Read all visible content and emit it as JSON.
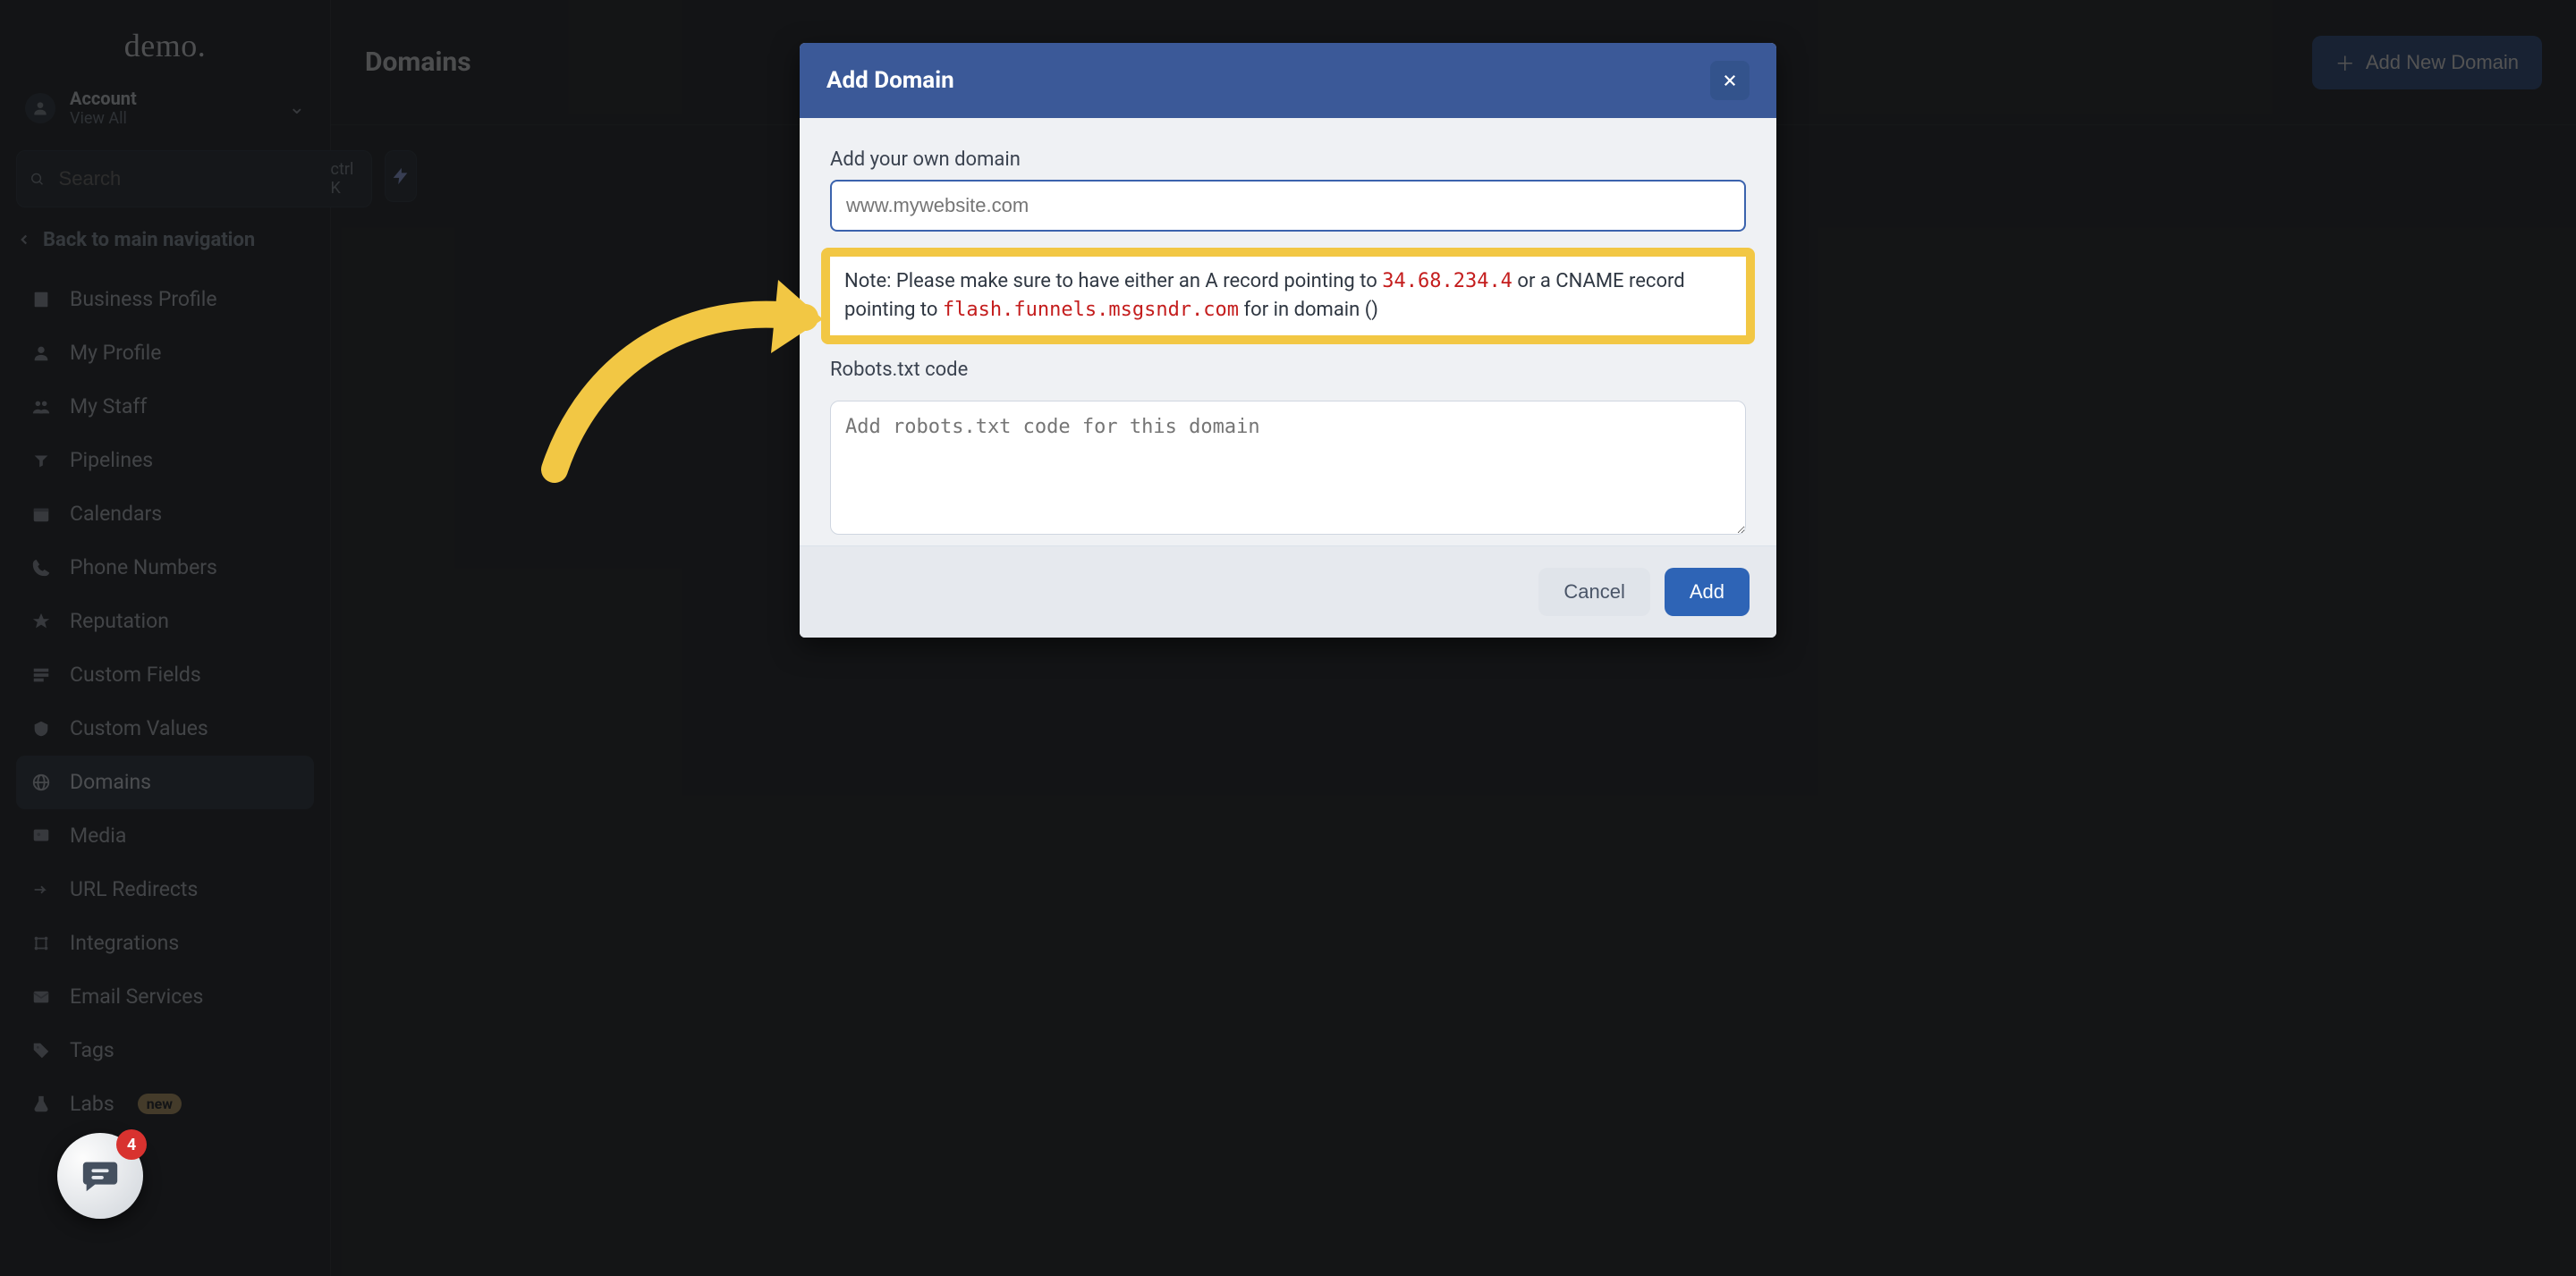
{
  "brand": {
    "logo_text": "demo."
  },
  "account": {
    "title": "Account",
    "view_text": "View All",
    "caret": "⌄"
  },
  "search": {
    "placeholder": "Search",
    "shortcut": "ctrl K"
  },
  "back_link": "Back to main navigation",
  "sidebar": {
    "items": [
      {
        "icon": "building-icon",
        "label": "Business Profile"
      },
      {
        "icon": "user-icon",
        "label": "My Profile"
      },
      {
        "icon": "team-icon",
        "label": "My Staff"
      },
      {
        "icon": "pipeline-icon",
        "label": "Pipelines"
      },
      {
        "icon": "calendar-icon",
        "label": "Calendars"
      },
      {
        "icon": "phone-icon",
        "label": "Phone Numbers"
      },
      {
        "icon": "star-icon",
        "label": "Reputation"
      },
      {
        "icon": "fields-icon",
        "label": "Custom Fields"
      },
      {
        "icon": "values-icon",
        "label": "Custom Values"
      },
      {
        "icon": "domains-icon",
        "label": "Domains",
        "active": true
      },
      {
        "icon": "media-icon",
        "label": "Media"
      },
      {
        "icon": "redirect-icon",
        "label": "URL Redirects"
      },
      {
        "icon": "integrations-icon",
        "label": "Integrations"
      },
      {
        "icon": "email-icon",
        "label": "Email Services"
      },
      {
        "icon": "tags-icon",
        "label": "Tags"
      },
      {
        "icon": "labs-icon",
        "label": "Labs",
        "badge": "new"
      }
    ]
  },
  "page": {
    "title": "Domains",
    "add_button": "Add New Domain"
  },
  "modal": {
    "title": "Add Domain",
    "domain_label": "Add your own domain",
    "domain_placeholder": "www.mywebsite.com",
    "note_prefix": "Note: Please make sure to have either an A record pointing to ",
    "note_ip": "34.68.234.4",
    "note_mid": " or a CNAME record pointing to ",
    "note_cname": "flash.funnels.msgsndr.com",
    "note_suffix": " for in domain ()",
    "robots_label": "Robots.txt code",
    "robots_placeholder": "Add robots.txt code for this domain",
    "cancel": "Cancel",
    "add": "Add"
  },
  "chat": {
    "badge": "4"
  },
  "colors": {
    "accent_yellow": "#f2c744",
    "modal_header": "#3b5998",
    "code_red": "#c41d1d",
    "primary_button": "#2e64b6"
  }
}
